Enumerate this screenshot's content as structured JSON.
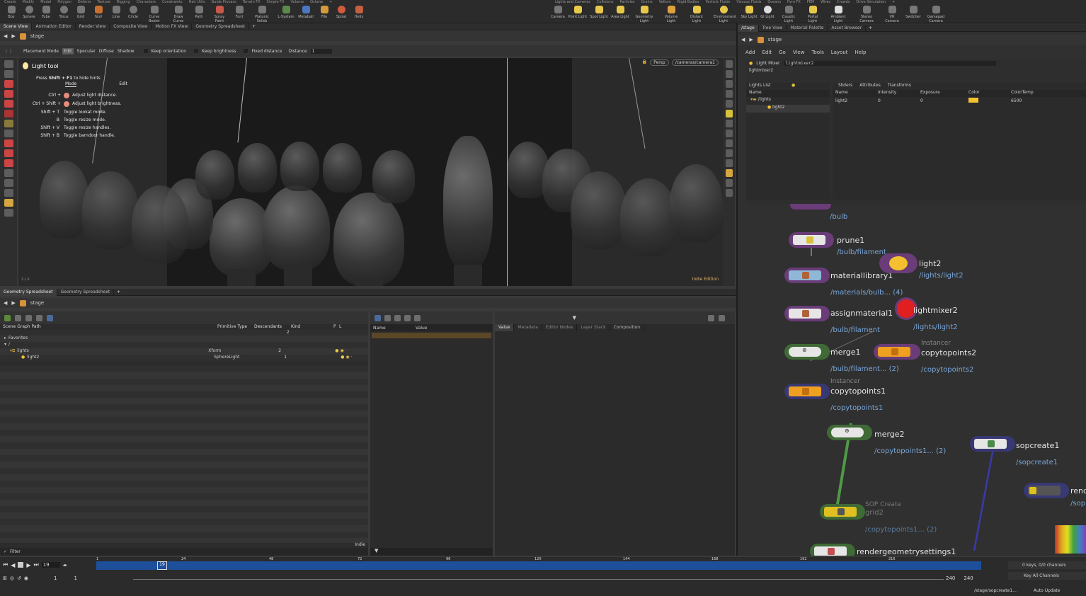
{
  "shelf": {
    "left_tabs": [
      "Create",
      "Modify",
      "Model",
      "Polygon",
      "Deform",
      "Texture",
      "Rigging",
      "Characters",
      "Constraints",
      "Hair Utils",
      "Guide Process",
      "Terrain FX",
      "Simple FX",
      "Volume",
      "Octane"
    ],
    "right_tabs": [
      "Lights and Cameras",
      "Collisions",
      "Particles",
      "Grains",
      "Vellum",
      "Rigid Bodies",
      "Particle Fluids",
      "Viscous Fluids",
      "Oceans",
      "Pyro FX",
      "FEM",
      "Wires",
      "Crowds",
      "Drive Simulation"
    ],
    "left_tools": [
      "Box",
      "Sphere",
      "Tube",
      "Torus",
      "Grid",
      "Null",
      "Line",
      "Circle",
      "Curve Bezier",
      "Draw Curve",
      "Path",
      "Spray Paint",
      "Font",
      "Platonic Solids",
      "L-System",
      "Metaball",
      "File",
      "Spiral",
      "Helix"
    ],
    "right_tools": [
      "Camera",
      "Point Light",
      "Spot Light",
      "Area Light",
      "Geometry Light",
      "Volume Light",
      "Distant Light",
      "Environment Light",
      "Sky Light",
      "GI Light",
      "Caustic Light",
      "Portal Light",
      "Ambient Light",
      "Stereo Camera",
      "VR Camera",
      "Switcher",
      "Gamepad Camera"
    ]
  },
  "left_tabs": [
    "Scene View",
    "Animation Editor",
    "Render View",
    "Composite View",
    "Motion FX View",
    "Geometry Spreadsheet"
  ],
  "left_path": "stage",
  "viewer_toolbar": {
    "placement_mode": "Placement Mode",
    "edit": "Edit",
    "specular": "Specular",
    "diffuse": "Diffuse",
    "shadow": "Shadow",
    "keep_orientation": "Keep orientation",
    "keep_brightness": "Keep brightness",
    "fixed_distance": "Fixed distance",
    "distance_label": "Distance",
    "distance_value": "1"
  },
  "viewport": {
    "persp": "Persp",
    "camera": "/cameras/camera1",
    "edition": "Indie Edition",
    "tool_title": "Light tool",
    "hint_toggle_prefix": "Press",
    "hint_toggle_keys": "Shift + F1",
    "hint_toggle_suffix": "to hide hints",
    "mode_label": "Mode",
    "mode_value": "Edit",
    "hints": [
      {
        "key": "Ctrl +",
        "text": "Adjust light distance."
      },
      {
        "key": "Ctrl + Shift +",
        "text": "Adjust light brightness."
      },
      {
        "key": "Shift + T",
        "text": "Toggle lookat mode."
      },
      {
        "key": "B",
        "text": "Toggle resize mode."
      },
      {
        "key": "Shift + V",
        "text": "Toggle resize handles."
      },
      {
        "key": "Shift + B",
        "text": "Toggle barndoor handle."
      }
    ]
  },
  "bottom_tabs": [
    "Geometry Spreadsheet",
    "Geometry Spreadsheet"
  ],
  "bottom_path": "stage",
  "scene_graph": {
    "headers": [
      "Scene Graph Path",
      "Primitive Type",
      "Descendants",
      "Kind",
      "P",
      "L"
    ],
    "rows": [
      {
        "name": "",
        "type": "",
        "desc": "2",
        "kind": ""
      },
      {
        "name": "Favorites",
        "type": "",
        "desc": "",
        "kind": ""
      },
      {
        "name": "/",
        "type": "",
        "desc": "",
        "kind": ""
      },
      {
        "name": "lights",
        "type": "Xform",
        "desc": "2",
        "kind": ""
      },
      {
        "name": "light2",
        "type": "SphereLight",
        "desc": "1",
        "kind": ""
      }
    ],
    "filter": "Filter",
    "indie": "Indie"
  },
  "props": {
    "headers": [
      "Name",
      "Value"
    ],
    "tabs": [
      "Value",
      "Metadata",
      "Editor Nodes",
      "Layer Stack",
      "Composition"
    ]
  },
  "right_tabs": [
    "/stage",
    "Tree View",
    "Material Palette",
    "Asset Browser"
  ],
  "right_path": "stage",
  "right_menu": [
    "Add",
    "Edit",
    "Go",
    "View",
    "Tools",
    "Layout",
    "Help"
  ],
  "light_mixer": {
    "title": "Light Mixer",
    "node": "lightmixer2",
    "subtitle": "lightmixer2",
    "lights_list_label": "Lights List",
    "tabs": [
      "Sliders",
      "Attributes",
      "Transforms"
    ],
    "list_header": "Name",
    "tree": [
      "/lights",
      "light2"
    ],
    "columns": [
      "Name",
      "Intensity",
      "Exposure",
      "Color",
      "ColorTemp"
    ],
    "row": {
      "name": "light2",
      "intensity": "0",
      "exposure": "0",
      "color": "#f2c230",
      "colortemp": "6500"
    }
  },
  "nodes": [
    {
      "label": "",
      "sub": "/bulb"
    },
    {
      "label": "prune1",
      "sub": "/bulb/filament"
    },
    {
      "label": "materiallibrary1",
      "sub": "/materials/bulb... (4)"
    },
    {
      "label": "assignmaterial1",
      "sub": "/bulb/filament"
    },
    {
      "label": "merge1",
      "sub": "/bulb/filament... (2)"
    },
    {
      "label": "copytopoints1",
      "sub": "/copytopoints1",
      "tag": "Instancer"
    },
    {
      "label": "light2",
      "sub": "/lights/light2"
    },
    {
      "label": "lightmixer2",
      "sub": "/lights/light2"
    },
    {
      "label": "copytopoints2",
      "sub": "/copytopoints2",
      "tag": "Instancer"
    },
    {
      "label": "merge2",
      "sub": "/copytopoints1... (2)"
    },
    {
      "label": "sopcreate1",
      "sub": "/sopcreate1"
    },
    {
      "label": "SOP Create",
      "sub": "grid2"
    },
    {
      "label": "",
      "sub": "/copytopoints1... (2)"
    },
    {
      "label": "rendergeometrysettings1",
      "sub": ""
    },
    {
      "label": "rend",
      "sub": "/sop"
    }
  ],
  "timeline": {
    "current_frame": "19",
    "ticks": [
      "1",
      "19",
      "24",
      "48",
      "72",
      "96",
      "120",
      "144",
      "168",
      "192",
      "216"
    ],
    "start": "1",
    "start2": "1",
    "end": "240",
    "end2": "240",
    "keys": "0 keys, 0/0 channels",
    "key_all": "Key All Channels",
    "status_path": "/stage/sopcreate1...",
    "auto_update": "Auto Update"
  }
}
